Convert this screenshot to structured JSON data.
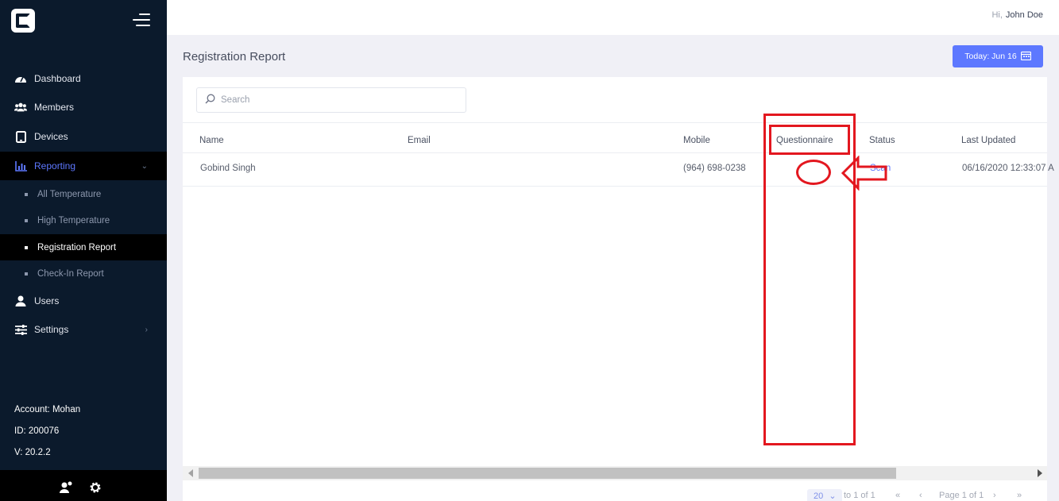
{
  "header": {
    "greeting": "Hi,",
    "user_name": "John Doe"
  },
  "sidebar": {
    "items": [
      {
        "label": "Dashboard",
        "icon": "dashboard-icon"
      },
      {
        "label": "Members",
        "icon": "users-group-icon"
      },
      {
        "label": "Devices",
        "icon": "tablet-icon"
      },
      {
        "label": "Reporting",
        "icon": "bar-chart-icon"
      },
      {
        "label": "Users",
        "icon": "user-icon"
      },
      {
        "label": "Settings",
        "icon": "sliders-icon"
      }
    ],
    "sub_items": [
      {
        "label": "All Temperature"
      },
      {
        "label": "High Temperature"
      },
      {
        "label": "Registration Report"
      },
      {
        "label": "Check-In Report"
      }
    ],
    "account": "Account: Mohan",
    "id": "ID: 200076",
    "version": "V: 20.2.2"
  },
  "page": {
    "title": "Registration Report",
    "date_button": "Today: Jun 16"
  },
  "search": {
    "placeholder": "Search"
  },
  "table": {
    "columns": [
      "Name",
      "Email",
      "Mobile",
      "Questionnaire",
      "Status",
      "Last Updated"
    ],
    "rows": [
      {
        "name": "Gobind Singh",
        "email": "",
        "mobile": "(964) 698-0238",
        "questionnaire": "",
        "status": "Scan",
        "last_updated": "06/16/2020 12:33:07 A"
      }
    ]
  },
  "pagination": {
    "page_size": "20",
    "range": "to 1 of 1",
    "page": "Page 1 of 1"
  },
  "colors": {
    "sidebar": "#0b1a2c",
    "accent": "#5d78ff",
    "annotation": "#e3171f"
  }
}
